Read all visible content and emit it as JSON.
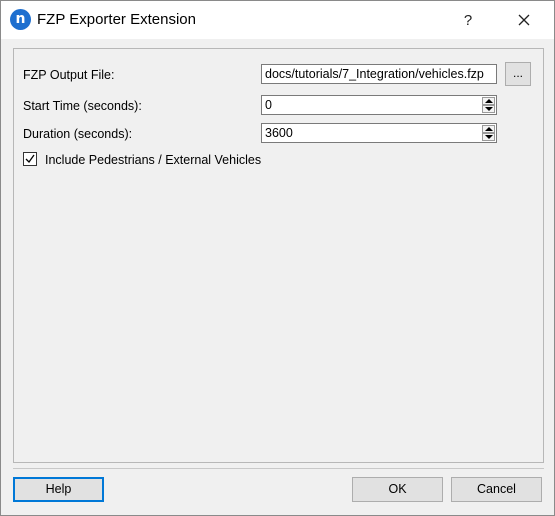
{
  "window": {
    "title": "FZP Exporter Extension",
    "icon_letter": "n",
    "help_glyph": "?",
    "close_glyph": "✕"
  },
  "form": {
    "output_file_label": "FZP Output File:",
    "output_file_value": "docs/tutorials/7_Integration/vehicles.fzp",
    "browse_label": "...",
    "start_time_label": "Start Time (seconds):",
    "start_time_value": "0",
    "duration_label": "Duration (seconds):",
    "duration_value": "3600",
    "include_label": "Include Pedestrians / External Vehicles",
    "include_checked": true
  },
  "footer": {
    "help_label": "Help",
    "ok_label": "OK",
    "cancel_label": "Cancel"
  },
  "colors": {
    "accent": "#0078d7",
    "app_icon": "#1e6fcf"
  }
}
